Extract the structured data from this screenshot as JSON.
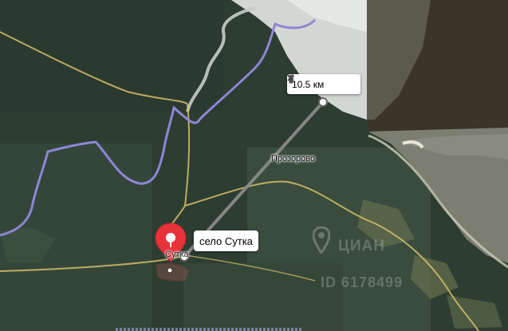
{
  "map": {
    "distance_label": "10.5 км",
    "place_tooltip": "село Сутка",
    "place_map_label": "Сутка",
    "village_map_label": "Прозорово",
    "watermark_text": "ЦИАН",
    "watermark_id": "ID 6178499",
    "delete_icon": "trash-icon",
    "close_icon": "close-icon",
    "marker_icon": "map-pin-icon",
    "colors": {
      "marker": "#e8323a",
      "ruler_line": "#8a8a8a",
      "boundary": "#8e86d6",
      "road": "#d6be6a",
      "water": "#c8ccc8"
    }
  }
}
